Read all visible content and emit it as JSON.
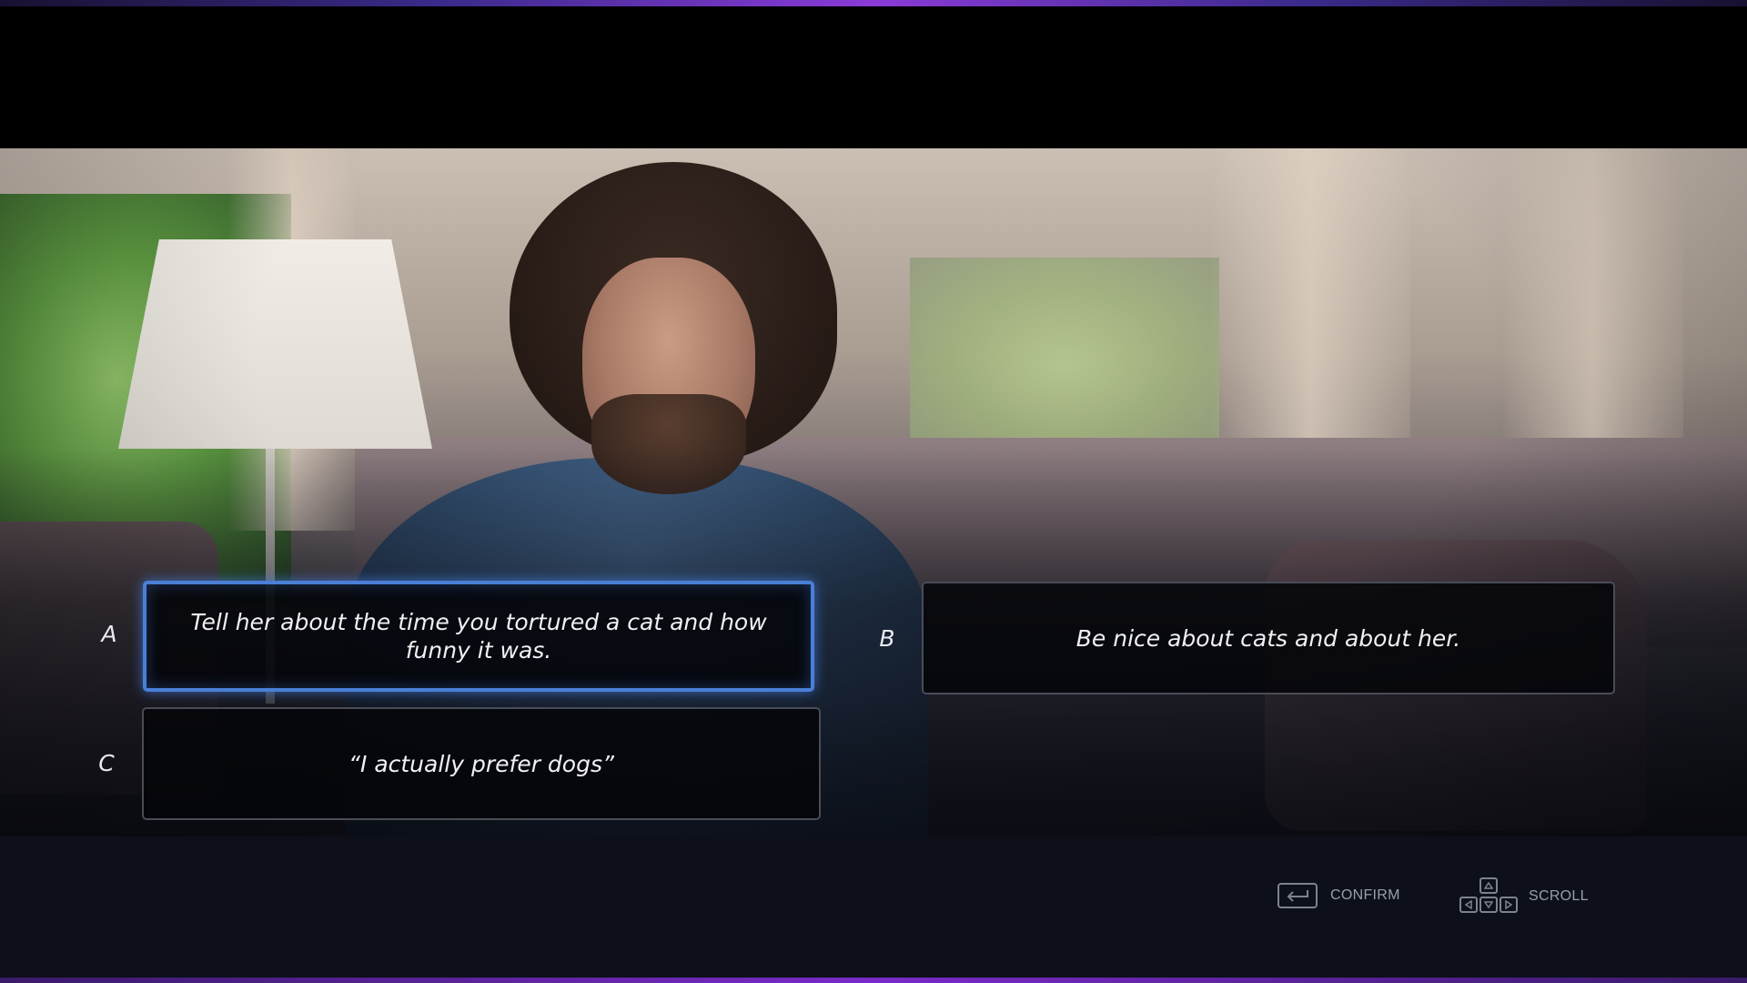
{
  "dialogue": {
    "choices": [
      {
        "letter": "A",
        "text": "Tell her about the time you tortured a cat and how funny it was.",
        "selected": true
      },
      {
        "letter": "B",
        "text": "Be nice about cats and about her.",
        "selected": false
      },
      {
        "letter": "C",
        "text": "“I actually prefer dogs”",
        "selected": false
      }
    ]
  },
  "controls": {
    "confirm_label": "CONFIRM",
    "scroll_label": "SCROLL",
    "confirm_icon": "enter-key-icon",
    "scroll_icon": "arrow-keys-icon"
  },
  "colors": {
    "selection_border": "#4a7fd6",
    "accent_glow": "#8a3ad8",
    "hud_background": "#0d1018"
  }
}
